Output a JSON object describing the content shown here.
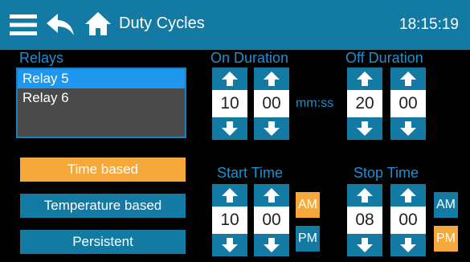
{
  "header": {
    "title": "Duty Cycles",
    "clock": "18:15:19"
  },
  "relays": {
    "label": "Relays",
    "items": [
      {
        "label": "Relay 5",
        "selected": true
      },
      {
        "label": "Relay 6",
        "selected": false
      }
    ]
  },
  "modes": {
    "time_based": "Time based",
    "temperature_based": "Temperature based",
    "persistent": "Persistent",
    "active": "Time based"
  },
  "on_duration": {
    "label": "On Duration",
    "minutes": "10",
    "seconds": "00"
  },
  "unit": "mm:ss",
  "off_duration": {
    "label": "Off Duration",
    "minutes": "20",
    "seconds": "00"
  },
  "start_time": {
    "label": "Start Time",
    "hours": "10",
    "minutes": "00",
    "am_label": "AM",
    "pm_label": "PM",
    "meridiem": "AM"
  },
  "stop_time": {
    "label": "Stop Time",
    "hours": "08",
    "minutes": "00",
    "am_label": "AM",
    "pm_label": "PM",
    "meridiem": "PM"
  },
  "icons": [
    "menu-icon",
    "back-icon",
    "home-icon",
    "arrow-up-icon",
    "arrow-down-icon"
  ],
  "colors": {
    "primary": "#137aa4",
    "accent": "#f6a83b",
    "label_blue": "#1e8fd2",
    "list_selected": "#1f96f0",
    "list_bg": "#4a4a4a"
  }
}
